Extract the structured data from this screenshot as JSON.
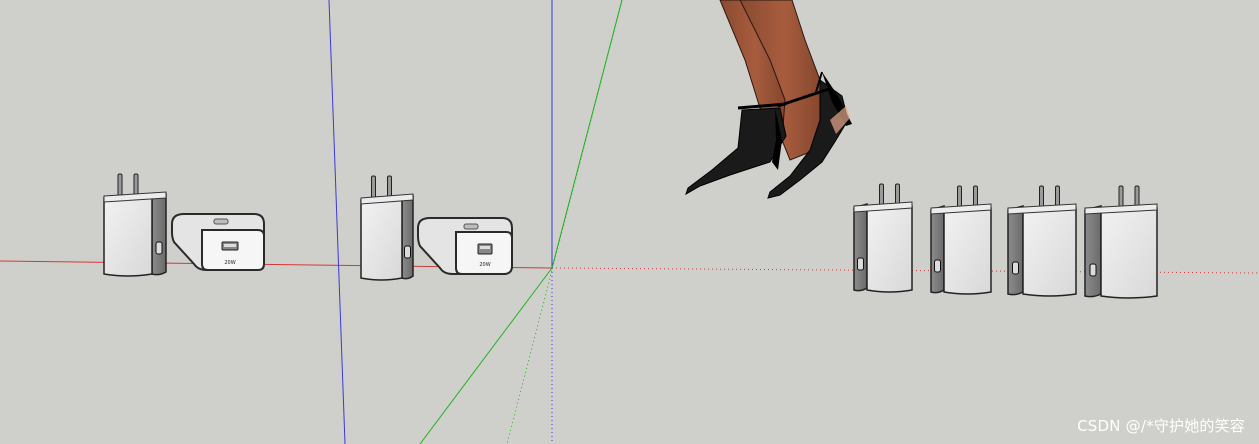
{
  "scene": {
    "background_color": "#cfd0cb",
    "axis_colors": {
      "red": "#d23a3a",
      "green": "#22b022",
      "blue": "#3a3ad6"
    },
    "objects": [
      {
        "name": "charger-upright",
        "count": 6
      },
      {
        "name": "charger-lying",
        "count": 2
      },
      {
        "name": "legs-high-heels",
        "count": 1
      }
    ],
    "charger_label": "20W"
  },
  "watermark": {
    "text": "CSDN @/*守护她的笑容"
  }
}
